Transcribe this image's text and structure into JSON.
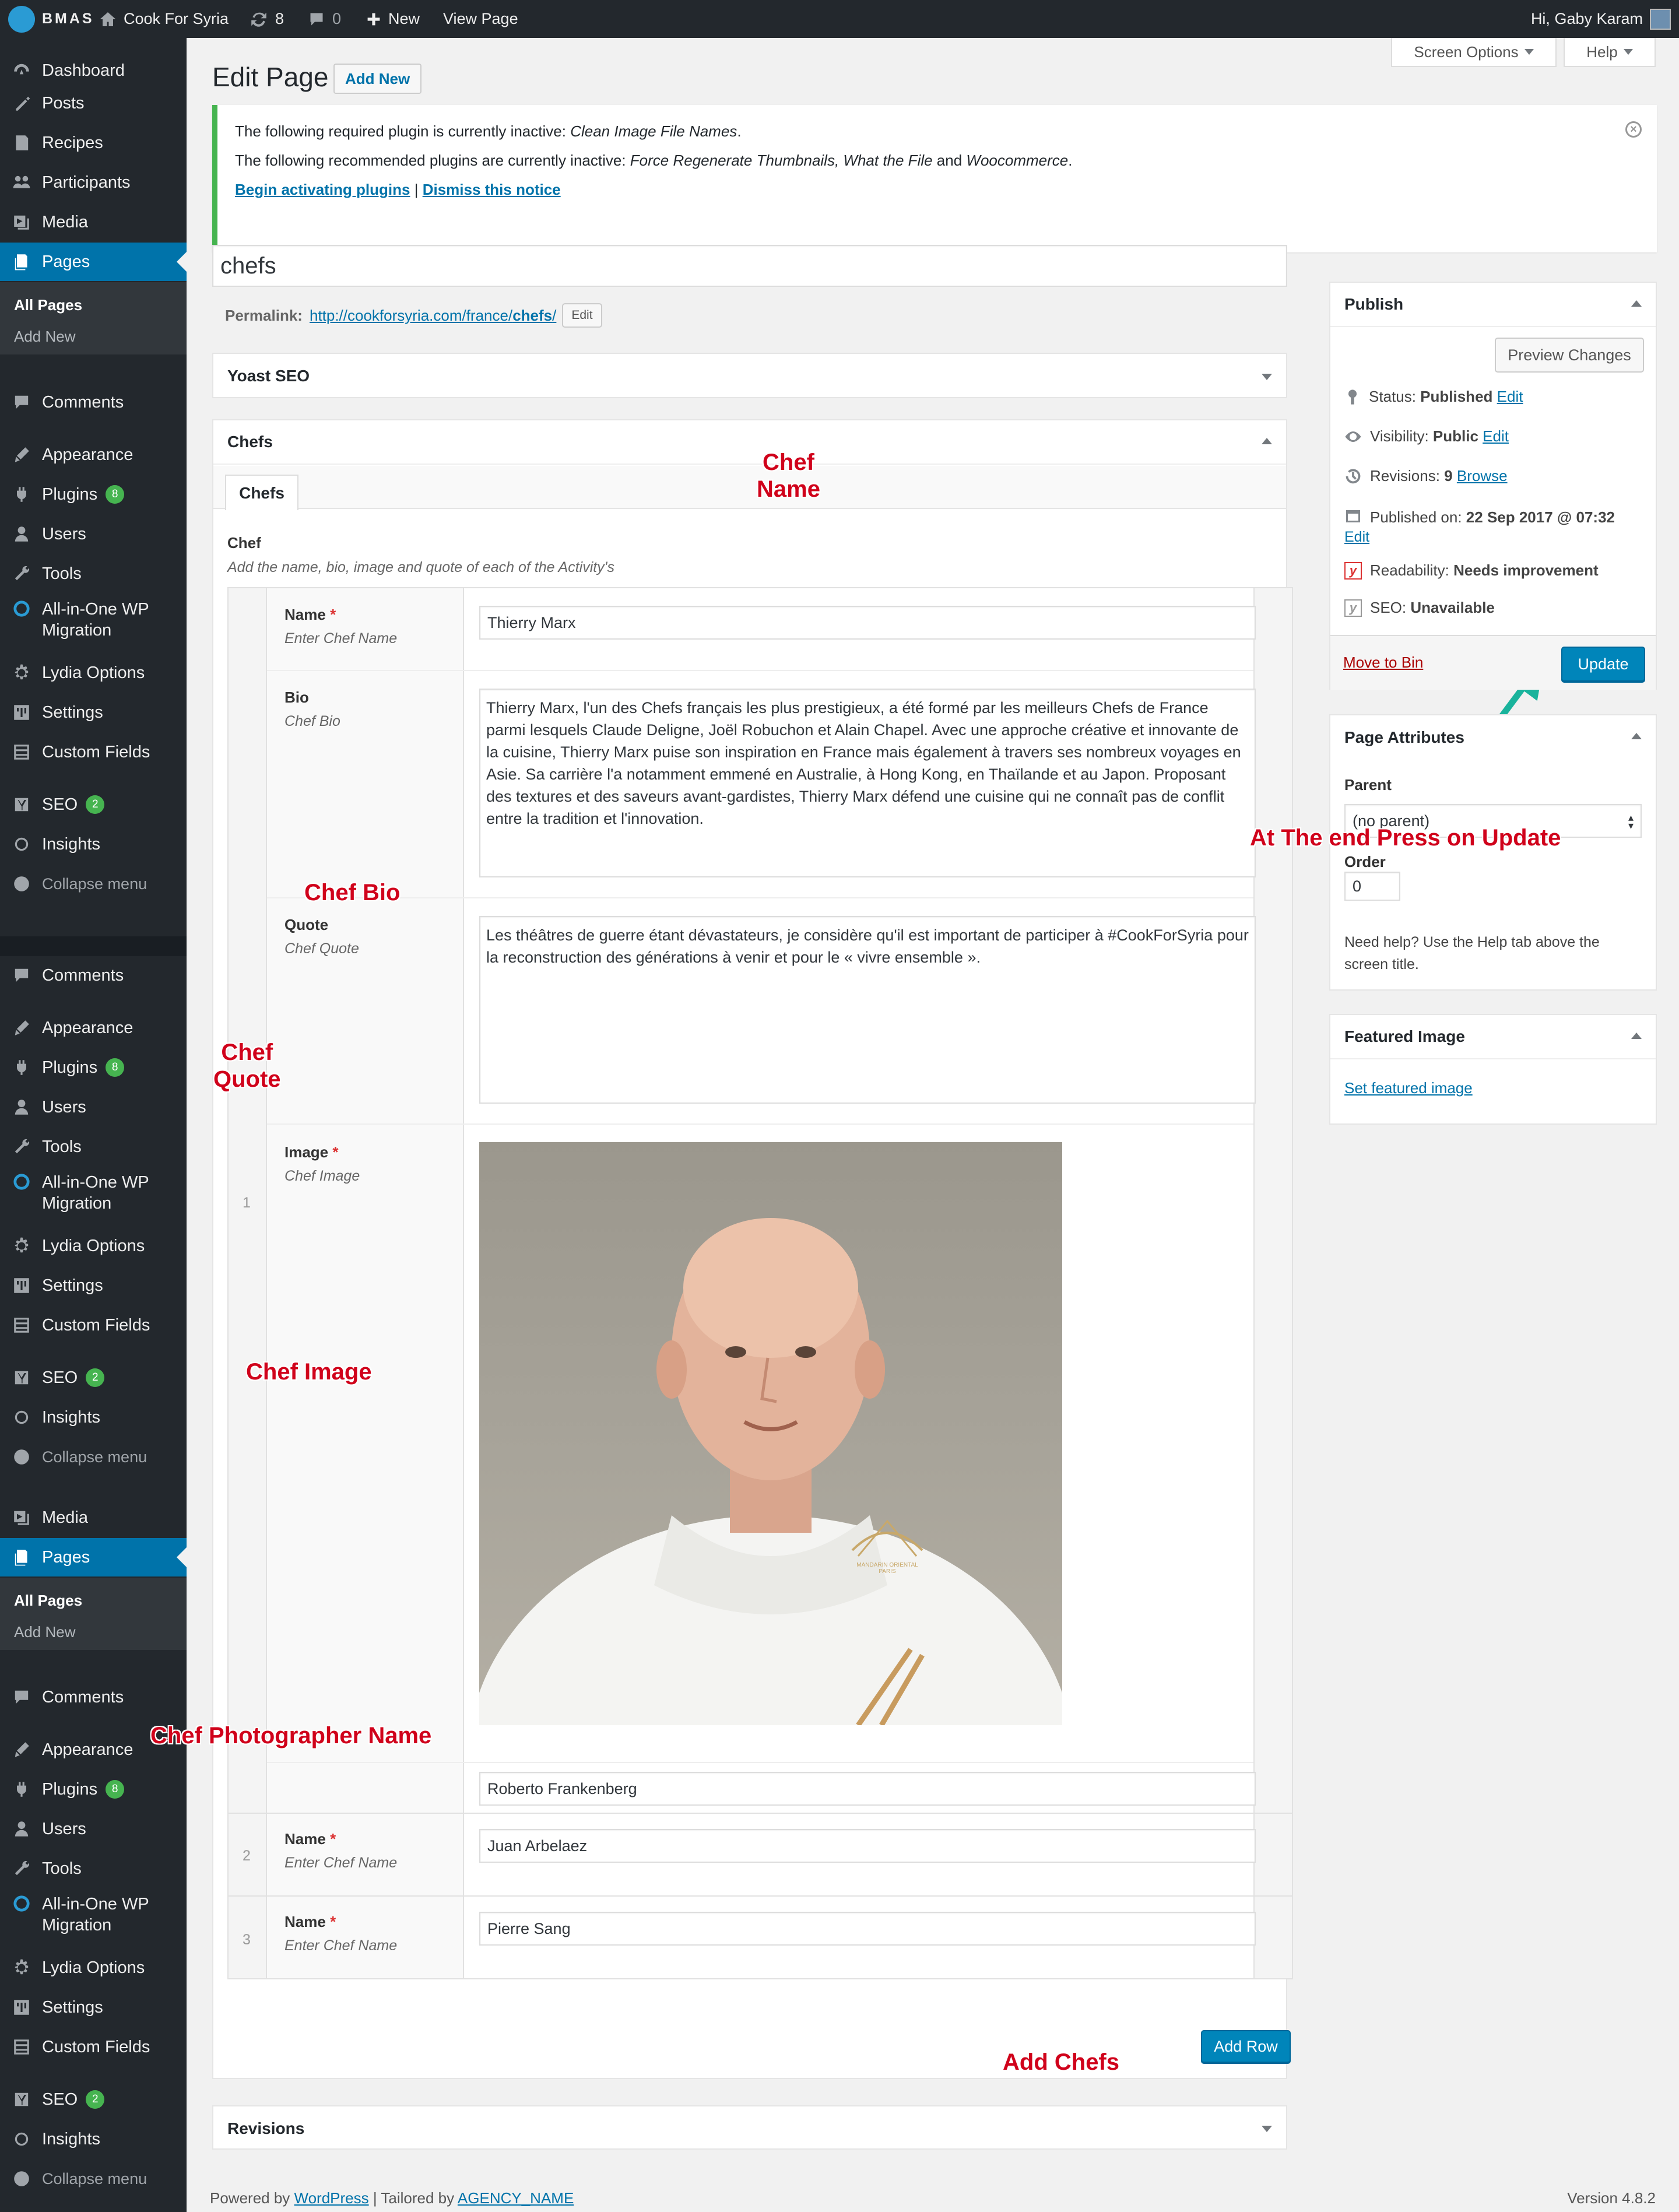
{
  "adminbar": {
    "logo_text": "BMAS",
    "site_name": "Cook For Syria",
    "updates_count": "8",
    "comments_count": "0",
    "new_label": "New",
    "view_page_label": "View Page",
    "greeting": "Hi, Gaby Karam"
  },
  "sidebar": {
    "group1": {
      "dashboard": "Dashboard",
      "posts": "Posts",
      "recipes": "Recipes",
      "participants": "Participants",
      "media": "Media",
      "pages": "Pages",
      "sub_all_pages": "All Pages",
      "sub_add_new": "Add New",
      "comments": "Comments",
      "appearance": "Appearance",
      "plugins": "Plugins",
      "plugins_badge": "8",
      "users": "Users",
      "tools": "Tools",
      "migration_line1": "All-in-One WP",
      "migration_line2": "Migration",
      "lydia": "Lydia Options",
      "settings": "Settings",
      "custom_fields": "Custom Fields",
      "seo": "SEO",
      "seo_badge": "2",
      "insights": "Insights",
      "collapse": "Collapse menu"
    },
    "group2": {
      "comments": "Comments",
      "appearance": "Appearance",
      "plugins": "Plugins",
      "plugins_badge": "8",
      "users": "Users",
      "tools": "Tools",
      "migration_line1": "All-in-One WP",
      "migration_line2": "Migration",
      "lydia": "Lydia Options",
      "settings": "Settings",
      "custom_fields": "Custom Fields",
      "seo": "SEO",
      "seo_badge": "2",
      "insights": "Insights",
      "collapse": "Collapse menu"
    },
    "group3": {
      "media": "Media",
      "pages": "Pages",
      "sub_all_pages": "All Pages",
      "sub_add_new": "Add New",
      "comments": "Comments",
      "appearance": "Appearance",
      "plugins": "Plugins",
      "plugins_badge": "8",
      "users": "Users",
      "tools": "Tools",
      "migration_line1": "All-in-One WP",
      "migration_line2": "Migration",
      "lydia": "Lydia Options",
      "settings": "Settings",
      "custom_fields": "Custom Fields",
      "seo": "SEO",
      "seo_badge": "2",
      "insights": "Insights",
      "collapse": "Collapse menu"
    }
  },
  "header": {
    "screen_options": "Screen Options",
    "help": "Help",
    "title": "Edit Page",
    "add_new": "Add New"
  },
  "notice": {
    "line1_prefix": "The following required plugin is currently inactive: ",
    "line1_plugin": "Clean Image File Names",
    "line1_suffix": ".",
    "line2_prefix": "The following recommended plugins are currently inactive: ",
    "line2_plugins": "Force Regenerate Thumbnails, What the File",
    "line2_and": " and ",
    "line2_last": "Woocommerce",
    "line2_suffix": ".",
    "begin_activating": "Begin activating plugins",
    "separator": " | ",
    "dismiss": "Dismiss this notice"
  },
  "editor": {
    "page_title": "chefs",
    "permalink_label": "Permalink:",
    "permalink_base": "http://cookforsyria.com/france/",
    "permalink_slug": "chefs",
    "permalink_end": "/",
    "permalink_edit": "Edit"
  },
  "yoast": {
    "title": "Yoast SEO"
  },
  "chefs_box": {
    "title": "Chefs",
    "tab": "Chefs",
    "field_label": "Chef",
    "field_desc": "Add the name, bio, image and quote of each of the Activity's",
    "rows": [
      {
        "num": "1",
        "name_label": "Name",
        "name_desc": "Enter Chef Name",
        "name_value": "Thierry Marx",
        "bio_label": "Bio",
        "bio_desc": "Chef Bio",
        "bio_value": "Thierry Marx, l'un des Chefs français les plus prestigieux, a été formé par les meilleurs Chefs de France parmi lesquels Claude Deligne, Joël Robuchon et Alain Chapel. Avec une approche créative et innovante de la cuisine, Thierry Marx puise son inspiration en France mais également à travers ses nombreux voyages en Asie. Sa carrière l'a notamment emmené en Australie, à Hong Kong, en Thaïlande et au Japon. Proposant des textures et des saveurs avant-gardistes, Thierry Marx défend une cuisine qui ne connaît pas de conflit entre la tradition et l'innovation.",
        "quote_label": "Quote",
        "quote_desc": "Chef Quote",
        "quote_value": "Les théâtres de guerre étant dévastateurs, je considère qu'il est important de participer à #CookForSyria pour la reconstruction des générations à venir et pour le « vivre ensemble ».",
        "image_label": "Image",
        "image_desc": "Chef Image",
        "image_embroidery_1": "MANDARIN ORIENTAL",
        "image_embroidery_2": "PARIS",
        "photographer_value": "Roberto Frankenberg"
      },
      {
        "num": "2",
        "name_label": "Name",
        "name_desc": "Enter Chef Name",
        "name_value": "Juan Arbelaez"
      },
      {
        "num": "3",
        "name_label": "Name",
        "name_desc": "Enter Chef Name",
        "name_value": "Pierre Sang"
      }
    ],
    "add_row": "Add Row"
  },
  "revisions": {
    "title": "Revisions"
  },
  "publish": {
    "title": "Publish",
    "preview": "Preview Changes",
    "status_label": "Status:",
    "status_value": "Published",
    "visibility_label": "Visibility:",
    "visibility_value": "Public",
    "revisions_label": "Revisions:",
    "revisions_value": "9",
    "browse": "Browse",
    "published_label": "Published on:",
    "published_value": "22 Sep 2017 @ 07:32",
    "edit": "Edit",
    "readability_label": "Readability:",
    "readability_value": "Needs improvement",
    "seo_label": "SEO:",
    "seo_value": "Unavailable",
    "move_to_bin": "Move to Bin",
    "update": "Update"
  },
  "attributes": {
    "title": "Page Attributes",
    "parent_label": "Parent",
    "parent_value": "(no parent)",
    "order_label": "Order",
    "order_value": "0",
    "help_line1": "Need help? Use the Help tab above the",
    "help_line2": "screen title."
  },
  "featured": {
    "title": "Featured Image",
    "set_link": "Set featured image"
  },
  "footer": {
    "powered_by": "Powered by ",
    "wordpress": "WordPress",
    "tailored": " | Tailored by ",
    "agency": "AGENCY_NAME",
    "version": "Version 4.8.2"
  },
  "annotations": {
    "chef_name_1": "Chef",
    "chef_name_2": "Name",
    "chef_bio": "Chef Bio",
    "chef_quote_1": "Chef",
    "chef_quote_2": "Quote",
    "chef_image": "Chef Image",
    "chef_photographer": "Chef Photographer Name",
    "update_hint": "At The end Press on Update",
    "add_chefs": "Add Chefs"
  },
  "colors": {
    "adminbar": "#23282d",
    "menu_active": "#0073aa",
    "primary_button": "#0085ba",
    "annotation_text": "#d0021b",
    "annotation_arrow": "#19b39c",
    "badge": "#46b450"
  }
}
